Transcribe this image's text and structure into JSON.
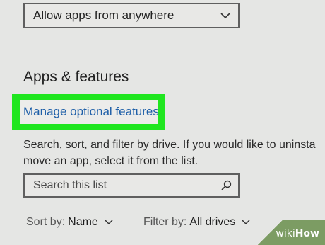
{
  "dropdown": {
    "label": "Allow apps from anywhere",
    "icon": "chevron-down-icon"
  },
  "section": {
    "title": "Apps & features"
  },
  "link": {
    "label": "Manage optional features",
    "highlight_color": "#1fe61f",
    "color": "#1f5fa8"
  },
  "description": {
    "line1": "Search, sort, and filter by drive. If you would like to uninsta",
    "line2": "move an app, select it from the list."
  },
  "search": {
    "placeholder": "Search this list",
    "icon": "search-icon"
  },
  "sort": {
    "label": "Sort by:",
    "value": "Name",
    "icon": "chevron-down-icon"
  },
  "filter": {
    "label": "Filter by:",
    "value": "All drives",
    "icon": "chevron-down-icon"
  },
  "watermark": {
    "part1": "wiki",
    "part2": "How"
  }
}
